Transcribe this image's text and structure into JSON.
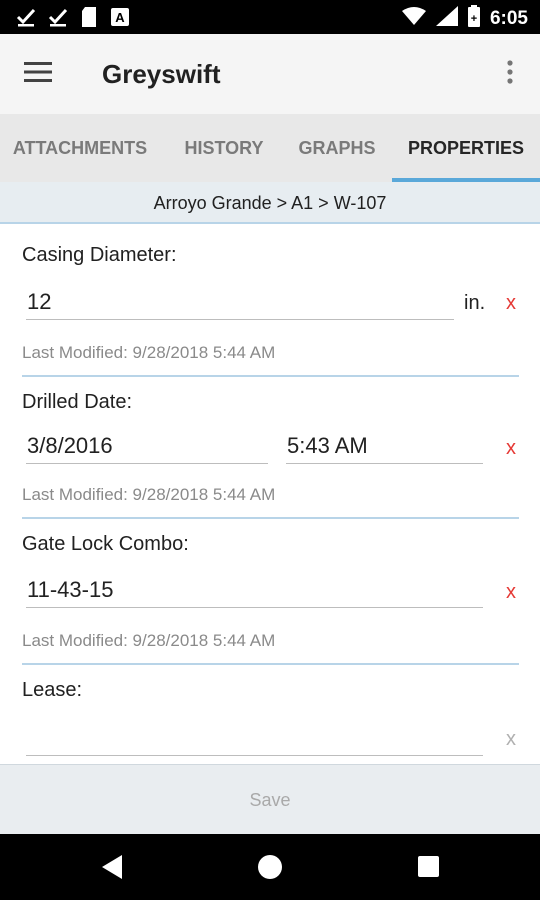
{
  "status_bar": {
    "time": "6:05",
    "icons_left": [
      "check-icon",
      "check-icon",
      "sd-card-icon",
      "text-a-icon"
    ],
    "icons_right": [
      "wifi-icon",
      "signal-icon",
      "battery-icon"
    ]
  },
  "app_bar": {
    "title": "Greyswift",
    "menu_icon": "hamburger-icon",
    "overflow_icon": "more-vert-icon"
  },
  "tabs": [
    {
      "label": "ATTACHMENTS",
      "active": false
    },
    {
      "label": "HISTORY",
      "active": false
    },
    {
      "label": "GRAPHS",
      "active": false
    },
    {
      "label": "PROPERTIES",
      "active": true
    }
  ],
  "breadcrumb": "Arroyo Grande > A1 > W-107",
  "properties": {
    "casing_diameter": {
      "label": "Casing Diameter:",
      "value": "12",
      "unit": "in.",
      "clear": "x",
      "modified": "Last Modified: 9/28/2018 5:44 AM"
    },
    "drilled_date": {
      "label": "Drilled Date:",
      "date": "3/8/2016",
      "time": "5:43 AM",
      "clear": "x",
      "modified": "Last Modified: 9/28/2018 5:44 AM"
    },
    "gate_lock_combo": {
      "label": "Gate Lock Combo:",
      "value": "11-43-15",
      "clear": "x",
      "modified": "Last Modified: 9/28/2018 5:44 AM"
    },
    "lease": {
      "label": "Lease:",
      "value": "",
      "clear": "x"
    }
  },
  "save_label": "Save",
  "colors": {
    "accent": "#5aa8d9",
    "clear_active": "#e53935",
    "clear_inactive": "#b0b0b0",
    "divider": "#b8d4e8"
  }
}
